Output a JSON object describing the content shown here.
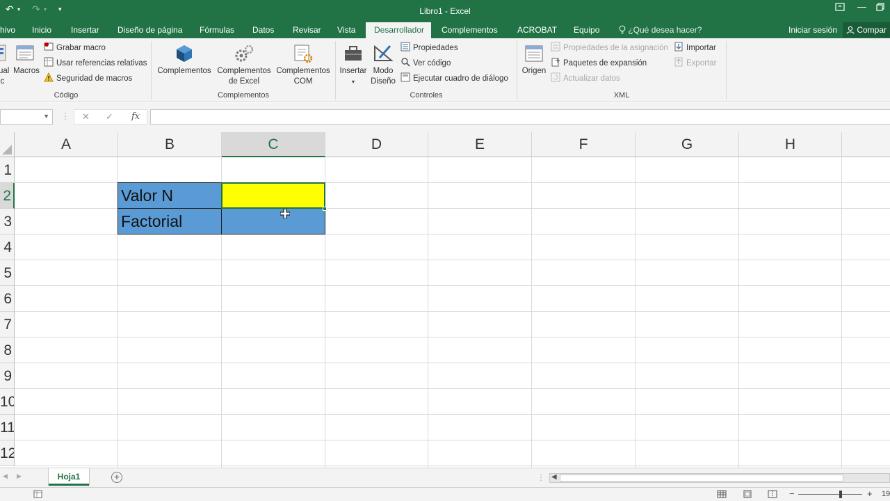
{
  "window": {
    "title": "Libro1 - Excel"
  },
  "tabs": [
    {
      "label": "hivo"
    },
    {
      "label": "Inicio"
    },
    {
      "label": "Insertar"
    },
    {
      "label": "Diseño de página"
    },
    {
      "label": "Fórmulas"
    },
    {
      "label": "Datos"
    },
    {
      "label": "Revisar"
    },
    {
      "label": "Vista"
    },
    {
      "label": "Desarrollador",
      "active": true
    },
    {
      "label": "Complementos"
    },
    {
      "label": "ACROBAT"
    },
    {
      "label": "Equipo"
    }
  ],
  "help": {
    "label": "¿Qué desea hacer?"
  },
  "account": {
    "signin": "Iniciar sesión",
    "share": "Compar"
  },
  "ribbon": {
    "codigo": {
      "label": "Código",
      "vb_partial_1": "ual",
      "vb_partial_2": "ic",
      "macros": "Macros",
      "grabar": "Grabar macro",
      "referencias": "Usar referencias relativas",
      "seguridad": "Seguridad de macros"
    },
    "complementos": {
      "label": "Complementos",
      "complementos": "Complementos",
      "excel_1": "Complementos",
      "excel_2": "de Excel",
      "com_1": "Complementos",
      "com_2": "COM"
    },
    "controles": {
      "label": "Controles",
      "insertar": "Insertar",
      "modo_1": "Modo",
      "modo_2": "Diseño",
      "propiedades": "Propiedades",
      "ver_codigo": "Ver código",
      "ejecutar": "Ejecutar cuadro de diálogo"
    },
    "xml": {
      "label": "XML",
      "origen": "Origen",
      "prop_asignacion": "Propiedades de la asignación",
      "paquetes": "Paquetes de expansión",
      "actualizar": "Actualizar datos",
      "importar": "Importar",
      "exportar": "Exportar"
    }
  },
  "formula_bar": {
    "name_box": "",
    "formula": ""
  },
  "grid": {
    "columns": [
      "A",
      "B",
      "C",
      "D",
      "E",
      "F",
      "G",
      "H"
    ],
    "selected_column": "C",
    "rows": [
      "1",
      "2",
      "3",
      "4",
      "5",
      "6",
      "7",
      "8",
      "9",
      "10",
      "11",
      "12"
    ],
    "selected_row": "2",
    "cells": {
      "B2": "Valor N",
      "B3": "Factorial",
      "C2": "",
      "C3": ""
    }
  },
  "sheets": [
    {
      "label": "Hoja1",
      "active": true
    }
  ],
  "status": {
    "zoom_partial": "19"
  },
  "colors": {
    "accent": "#217346",
    "cell_blue": "#5b9bd5",
    "cell_yellow": "#ffff00"
  }
}
